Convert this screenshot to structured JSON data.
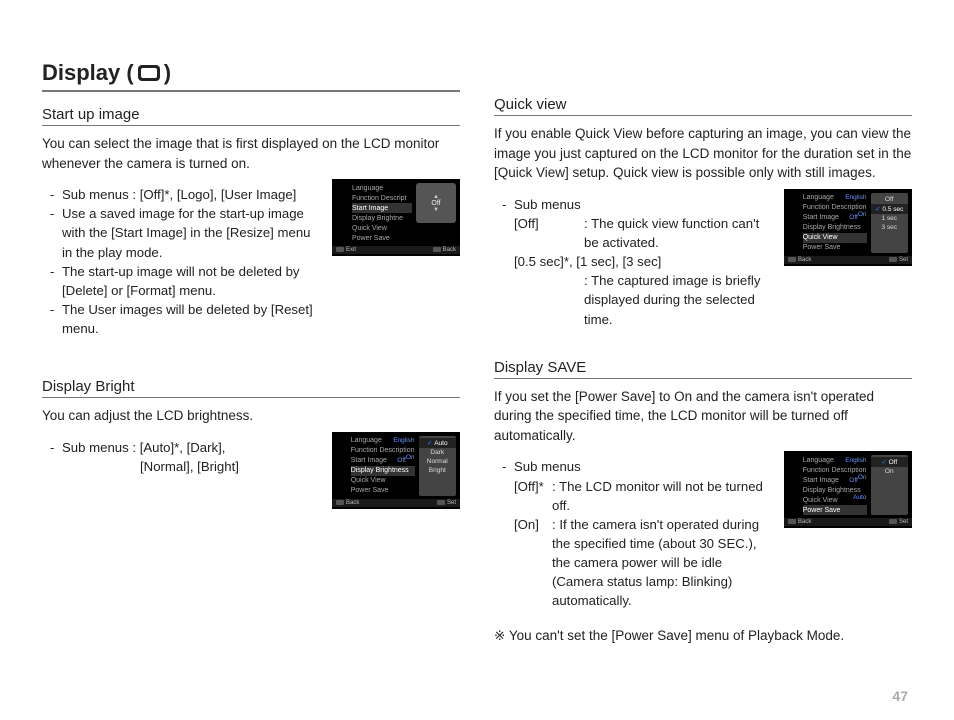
{
  "pageNumber": "47",
  "title": {
    "part1": "Display (",
    "part2": ")"
  },
  "startUp": {
    "heading": "Start up image",
    "intro": "You can select the image that is first displayed on the LCD monitor whenever the camera is turned on.",
    "b1": "Sub menus : [Off]*, [Logo], [User Image]",
    "b2": "Use a saved image for the start-up image with the [Start Image] in the [Resize] menu in the play mode.",
    "b3": "The start-up image will not be deleted by [Delete] or [Format] menu.",
    "b4": "The User images will be deleted by [Reset] menu.",
    "screen": {
      "items": [
        "Language",
        "Function Descript",
        "Start Image",
        "Display  Brightne",
        "Quick View",
        "Power Save"
      ],
      "selectedIndex": 2,
      "optLabel": "Off",
      "footerLeft": "Exit",
      "footerRight": "Back"
    }
  },
  "bright": {
    "heading": "Display Bright",
    "intro": "You can adjust the LCD brightness.",
    "b1": "Sub menus : [Auto]*, [Dark],",
    "b1cont": "[Normal], [Bright]",
    "screen": {
      "items": [
        "Language",
        "Function Description",
        "Start Image",
        "Display  Brightness",
        "Quick View",
        "Power Save"
      ],
      "rightVals": [
        "English",
        "On",
        "Off",
        "",
        "",
        ""
      ],
      "selectedIndex": 3,
      "opts": [
        "Auto",
        "Dark",
        "Normal",
        "Bright"
      ],
      "optSel": 0,
      "footerLeft": "Back",
      "footerRight": "Set"
    }
  },
  "quick": {
    "heading": "Quick view",
    "intro": "If you enable Quick View before capturing an image, you can view the image you just captured on the LCD monitor for the duration set in the [Quick View] setup. Quick view is possible only with still images.",
    "subHead": "Sub menus",
    "offLabel": "[Off]",
    "offDesc": ": The quick view function can't be activated.",
    "timesLabel": "[0.5 sec]*, [1 sec], [3 sec]",
    "timesDesc": ": The captured image is briefly displayed during the selected time.",
    "screen": {
      "items": [
        "Language",
        "Function Description",
        "Start Image",
        "Display  Brightness",
        "Quick View",
        "Power Save"
      ],
      "rightVals": [
        "English",
        "On",
        "Off",
        "",
        "",
        ""
      ],
      "selectedIndex": 4,
      "opts": [
        "Off",
        "0.5 sec",
        "1 sec",
        "3 sec"
      ],
      "optSel": 1,
      "footerLeft": "Back",
      "footerRight": "Set"
    }
  },
  "save": {
    "heading": "Display SAVE",
    "intro": "If you set the [Power Save] to On and the camera isn't operated during the specified time, the LCD monitor will be turned off automatically.",
    "subHead": "Sub menus",
    "offLabel": "[Off]*",
    "offDesc": ": The LCD monitor will not be turned off.",
    "onLabel": "[On]",
    "onDesc": ": If the camera isn't operated during the specified time (about 30 SEC.), the camera power will be idle (Camera status lamp: Blinking) automatically.",
    "note": "※ You can't set the [Power Save] menu of Playback Mode.",
    "screen": {
      "items": [
        "Language",
        "Function Description",
        "Start Image",
        "Display  Brightness",
        "Quick View",
        "Power Save"
      ],
      "rightVals": [
        "English",
        "On",
        "Off",
        "Auto",
        "",
        ""
      ],
      "selectedIndex": 5,
      "opts": [
        "Off",
        "On"
      ],
      "optSel": 0,
      "footerLeft": "Back",
      "footerRight": "Set"
    }
  }
}
